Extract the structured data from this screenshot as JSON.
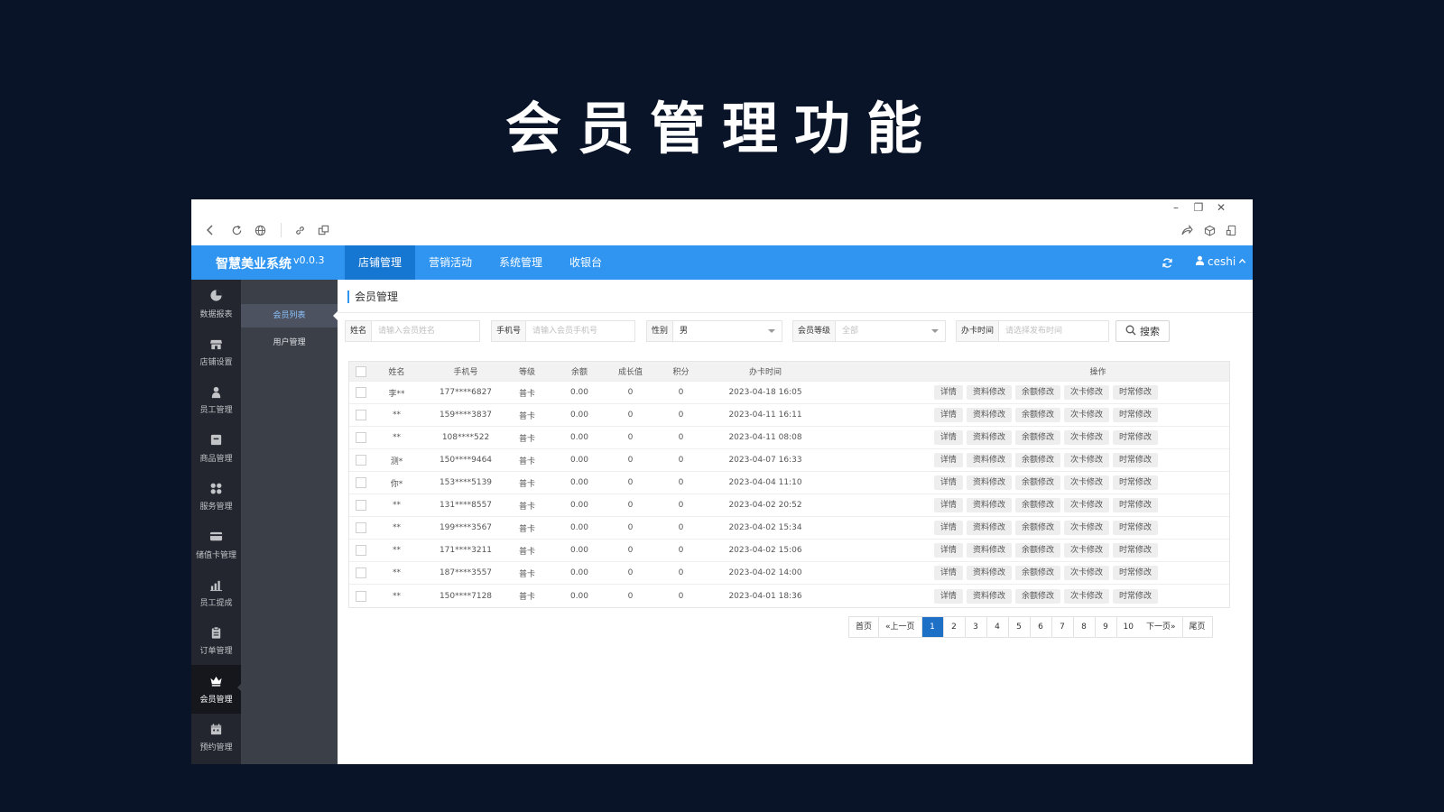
{
  "slide": {
    "title": "会员管理功能"
  },
  "window": {
    "controls": {
      "minimize": "–",
      "restore": "❐",
      "close": "✕"
    }
  },
  "header": {
    "brand": "智慧美业系统",
    "version": "v0.0.3",
    "nav": [
      "店铺管理",
      "营销活动",
      "系统管理",
      "收银台"
    ],
    "active_nav": 0,
    "user": "ceshi",
    "accent": "#2f95f0"
  },
  "sidebar": {
    "items": [
      {
        "label": "数据报表",
        "icon": "pie-chart-icon"
      },
      {
        "label": "店铺设置",
        "icon": "store-icon"
      },
      {
        "label": "员工管理",
        "icon": "user-icon"
      },
      {
        "label": "商品管理",
        "icon": "box-icon"
      },
      {
        "label": "服务管理",
        "icon": "grid-icon"
      },
      {
        "label": "储值卡管理",
        "icon": "card-icon"
      },
      {
        "label": "员工提成",
        "icon": "bar-chart-icon"
      },
      {
        "label": "订单管理",
        "icon": "clipboard-icon"
      },
      {
        "label": "会员管理",
        "icon": "crown-icon"
      },
      {
        "label": "预约管理",
        "icon": "calendar-icon"
      }
    ],
    "active_index": 8
  },
  "subnav": {
    "items": [
      "会员列表",
      "用户管理"
    ],
    "active_index": 0
  },
  "page": {
    "title": "会员管理"
  },
  "filters": {
    "name": {
      "label": "姓名",
      "placeholder": "请输入会员姓名"
    },
    "phone": {
      "label": "手机号",
      "placeholder": "请输入会员手机号"
    },
    "gender": {
      "label": "性别",
      "value": "男"
    },
    "level": {
      "label": "会员等级",
      "value": "全部"
    },
    "date": {
      "label": "办卡时间",
      "placeholder": "请选择发布时间"
    },
    "search_label": "搜索"
  },
  "table": {
    "headers": {
      "name": "姓名",
      "phone": "手机号",
      "level": "等级",
      "balance": "余额",
      "growth": "成长值",
      "points": "积分",
      "time": "办卡时间",
      "ops": "操作"
    },
    "op_labels": [
      "详情",
      "资料修改",
      "余额修改",
      "次卡修改",
      "时常修改"
    ],
    "rows": [
      {
        "name": "李**",
        "phone": "177****6827",
        "level": "普卡",
        "balance": "0.00",
        "growth": "0",
        "points": "0",
        "time": "2023-04-18 16:05"
      },
      {
        "name": "**",
        "phone": "159****3837",
        "level": "普卡",
        "balance": "0.00",
        "growth": "0",
        "points": "0",
        "time": "2023-04-11 16:11"
      },
      {
        "name": "**",
        "phone": "108****522",
        "level": "普卡",
        "balance": "0.00",
        "growth": "0",
        "points": "0",
        "time": "2023-04-11 08:08"
      },
      {
        "name": "测*",
        "phone": "150****9464",
        "level": "普卡",
        "balance": "0.00",
        "growth": "0",
        "points": "0",
        "time": "2023-04-07 16:33"
      },
      {
        "name": "你*",
        "phone": "153****5139",
        "level": "普卡",
        "balance": "0.00",
        "growth": "0",
        "points": "0",
        "time": "2023-04-04 11:10"
      },
      {
        "name": "**",
        "phone": "131****8557",
        "level": "普卡",
        "balance": "0.00",
        "growth": "0",
        "points": "0",
        "time": "2023-04-02 20:52"
      },
      {
        "name": "**",
        "phone": "199****3567",
        "level": "普卡",
        "balance": "0.00",
        "growth": "0",
        "points": "0",
        "time": "2023-04-02 15:34"
      },
      {
        "name": "**",
        "phone": "171****3211",
        "level": "普卡",
        "balance": "0.00",
        "growth": "0",
        "points": "0",
        "time": "2023-04-02 15:06"
      },
      {
        "name": "**",
        "phone": "187****3557",
        "level": "普卡",
        "balance": "0.00",
        "growth": "0",
        "points": "0",
        "time": "2023-04-02 14:00"
      },
      {
        "name": "**",
        "phone": "150****7128",
        "level": "普卡",
        "balance": "0.00",
        "growth": "0",
        "points": "0",
        "time": "2023-04-01 18:36"
      }
    ]
  },
  "pagination": {
    "first": "首页",
    "prev": "«上一页",
    "pages": [
      "1",
      "2",
      "3",
      "4",
      "5",
      "6",
      "7",
      "8",
      "9",
      "10"
    ],
    "current": "1",
    "next": "下一页»",
    "last": "尾页"
  }
}
